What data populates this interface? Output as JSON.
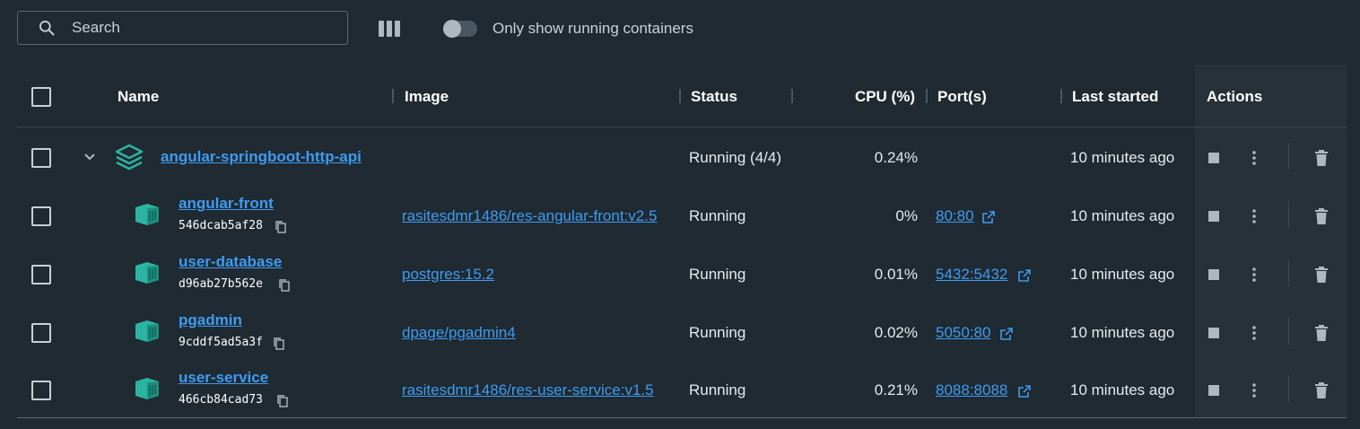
{
  "toolbar": {
    "search_placeholder": "Search",
    "columns_icon": "columns-icon",
    "toggle_label": "Only show running containers"
  },
  "table": {
    "headers": {
      "name": "Name",
      "image": "Image",
      "status": "Status",
      "cpu": "CPU (%)",
      "ports": "Port(s)",
      "last_started": "Last started",
      "actions": "Actions"
    },
    "group": {
      "name": "angular-springboot-http-api",
      "status": "Running (4/4)",
      "cpu": "0.24%",
      "last_started": "10 minutes ago"
    },
    "containers": [
      {
        "name": "angular-front",
        "id": "546dcab5af28",
        "image": "rasitesdmr1486/res-angular-front:v2.5",
        "status": "Running",
        "cpu": "0%",
        "port": "80:80",
        "last_started": "10 minutes ago"
      },
      {
        "name": "user-database",
        "id": "d96ab27b562e",
        "image": "postgres:15.2",
        "status": "Running",
        "cpu": "0.01%",
        "port": "5432:5432",
        "last_started": "10 minutes ago"
      },
      {
        "name": "pgadmin",
        "id": "9cddf5ad5a3f",
        "image": "dpage/pgadmin4",
        "status": "Running",
        "cpu": "0.02%",
        "port": "5050:80",
        "last_started": "10 minutes ago"
      },
      {
        "name": "user-service",
        "id": "466cb84cad73",
        "image": "rasitesdmr1486/res-user-service:v1.5",
        "status": "Running",
        "cpu": "0.21%",
        "port": "8088:8088",
        "last_started": "10 minutes ago"
      }
    ]
  },
  "colors": {
    "background": "#1f2a32",
    "actions_column": "#263139",
    "link": "#3f9bf0",
    "container_icon": "#2bb5a0"
  }
}
